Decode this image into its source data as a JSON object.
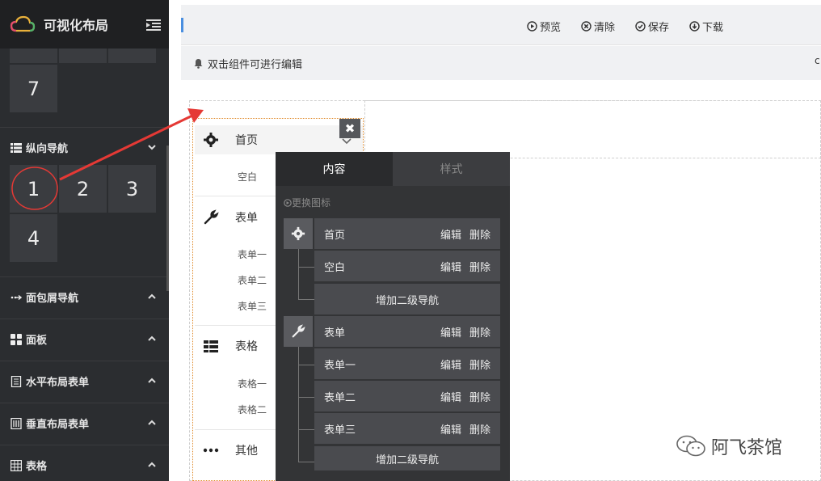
{
  "sidebar": {
    "title": "可视化布局",
    "grid_top": [
      "7"
    ],
    "vertical_nav_label": "纵向导航",
    "vertical_nav_cells": [
      "1",
      "2",
      "3",
      "4"
    ],
    "sections": [
      {
        "label": "面包屑导航",
        "icon": "breadcrumb-icon"
      },
      {
        "label": "面板",
        "icon": "panel-grid-icon"
      },
      {
        "label": "水平布局表单",
        "icon": "form-doc-icon"
      },
      {
        "label": "垂直布局表单",
        "icon": "vertical-form-icon"
      },
      {
        "label": "表格",
        "icon": "table-icon"
      }
    ]
  },
  "toolbar": {
    "preview": "预览",
    "clear": "清除",
    "save": "保存",
    "download": "下载"
  },
  "hint": "双击组件可进行编辑",
  "right_clip": "c",
  "vnav_preview": {
    "items": [
      {
        "label": "首页",
        "icon": "gear-icon",
        "subs": [
          "空白"
        ]
      },
      {
        "label": "表单",
        "icon": "wrench-icon",
        "subs": [
          "表单一",
          "表单二",
          "表单三"
        ]
      },
      {
        "label": "表格",
        "icon": "table-icon",
        "subs": [
          "表格一",
          "表格二"
        ]
      },
      {
        "label": "其他",
        "icon": "ellipsis-icon",
        "subs": []
      }
    ],
    "close": "✖"
  },
  "panel": {
    "tab_content": "内容",
    "tab_style": "样式",
    "change_icon": "更换图标",
    "edit": "编辑",
    "delete": "删除",
    "add_secondary": "增加二级导航",
    "groups": [
      {
        "label": "首页",
        "icon": "gear-icon",
        "children": [
          "空白"
        ]
      },
      {
        "label": "表单",
        "icon": "wrench-icon",
        "children": [
          "表单一",
          "表单二",
          "表单三"
        ]
      }
    ]
  },
  "watermark": "阿飞茶馆",
  "colors": {
    "sidebar_bg": "#2b2d30",
    "panel_bg": "#333436",
    "accent": "#4a8fe0",
    "annotation_red": "#e53935",
    "vnav_border": "#e08a2a"
  }
}
